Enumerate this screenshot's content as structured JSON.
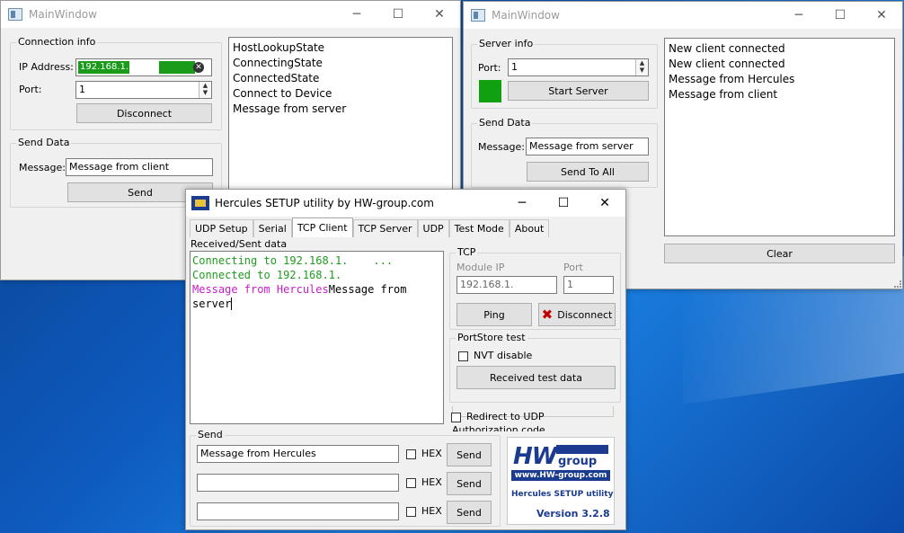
{
  "left_window": {
    "title": "MainWindow",
    "connection_group": "Connection info",
    "ip_label": "IP Address:",
    "ip_value": "192.168.1.",
    "port_label": "Port:",
    "port_value": "1",
    "disconnect": "Disconnect",
    "send_group": "Send Data",
    "message_label": "Message:",
    "message_value": "Message from client",
    "send": "Send",
    "log": [
      "HostLookupState",
      "ConnectingState",
      "ConnectedState",
      "Connect to Device",
      "Message from server"
    ],
    "ip_field_color": "#1a9c1a"
  },
  "right_window": {
    "title": "MainWindow",
    "server_group": "Server info",
    "port_label": "Port:",
    "port_value": "1",
    "status_color": "#10a010",
    "start_server": "Start Server",
    "send_group": "Send Data",
    "message_label": "Message:",
    "message_value": "Message from server",
    "send_to_all": "Send To All",
    "log": [
      "New client connected",
      "New client connected",
      "Message from Hercules",
      "Message from client"
    ],
    "clear": "Clear"
  },
  "hercules": {
    "title": "Hercules SETUP utility by HW-group.com",
    "tabs": [
      "UDP Setup",
      "Serial",
      "TCP Client",
      "TCP Server",
      "UDP",
      "Test Mode",
      "About"
    ],
    "received_label": "Received/Sent data",
    "term": {
      "line1": "Connecting to 192.168.1.",
      "line1b": "...",
      "line2": "Connected to 192.168.1.",
      "line3a": "Message from Hercules",
      "line3b": "Message from",
      "line4": "server"
    },
    "tcp_group": "TCP",
    "module_ip_label": "Module IP",
    "port_label": "Port",
    "module_ip_value": "192.168.1.",
    "port_value": "1",
    "ping": "Ping",
    "disconnect": "Disconnect",
    "portstore_group": "PortStore test",
    "nvt_disable": "NVT disable",
    "received_test": "Received test data",
    "redirect_udp": "Redirect to UDP",
    "auth_code": "Authorization code",
    "send_group": "Send",
    "send_rows": [
      {
        "value": "Message from Hercules",
        "hex": "HEX",
        "send": "Send"
      },
      {
        "value": "",
        "hex": "HEX",
        "send": "Send"
      },
      {
        "value": "",
        "hex": "HEX",
        "send": "Send"
      }
    ],
    "logo": {
      "hw": "HW",
      "group": "group",
      "url": "www.HW-group.com",
      "product": "Hercules SETUP utility",
      "version": "Version  3.2.8"
    }
  }
}
